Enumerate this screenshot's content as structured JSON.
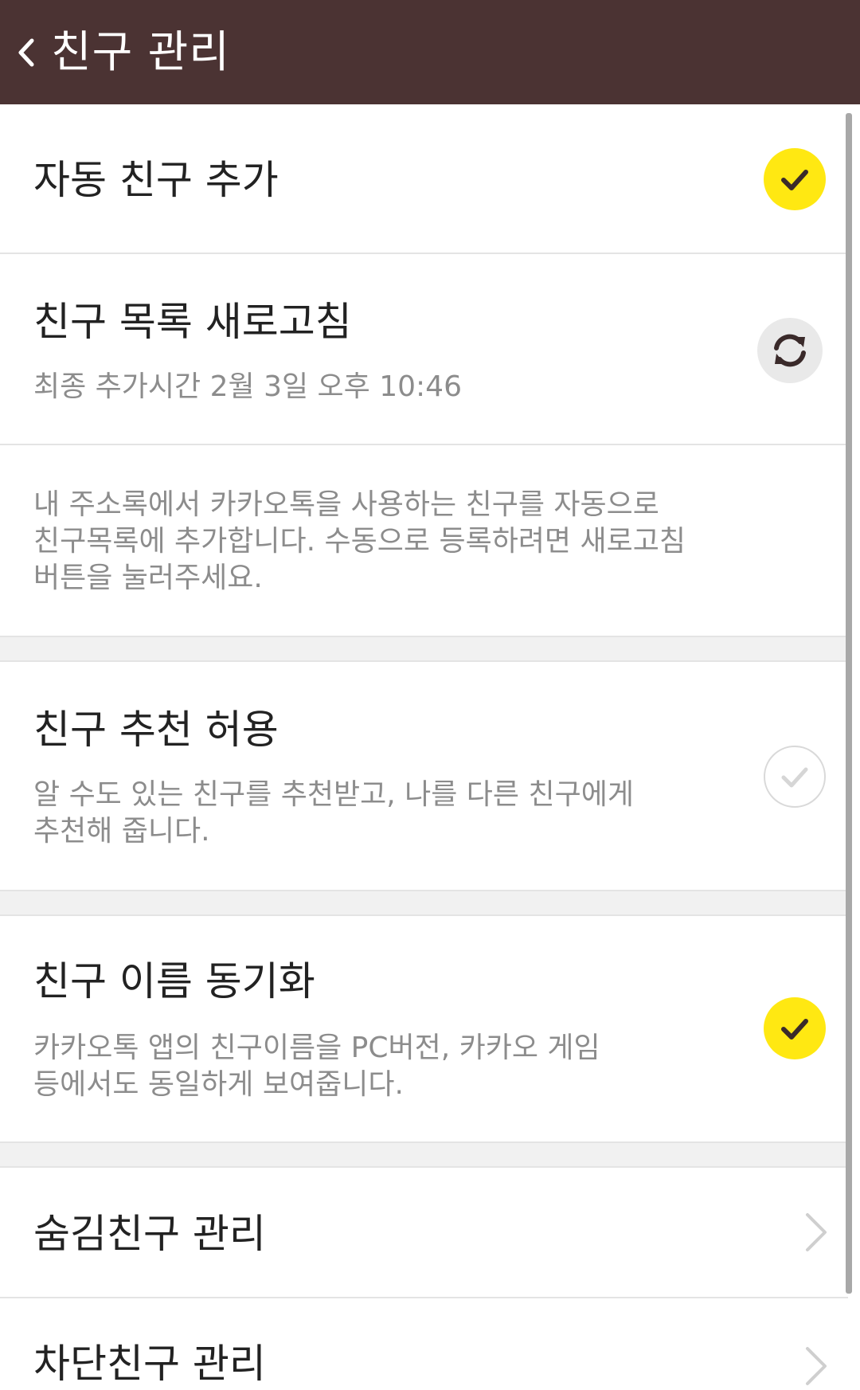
{
  "header": {
    "title": "친구 관리",
    "back_icon": "chevron-left-icon",
    "background": "#4b3333"
  },
  "settings": {
    "auto_add": {
      "title": "자동 친구 추가",
      "checked": true,
      "icon": "check-icon"
    },
    "refresh": {
      "title": "친구 목록 새로고침",
      "last_added": "최종 추가시간 2월 3일 오후 10:46",
      "icon": "refresh-icon"
    },
    "auto_add_description": [
      "내 주소록에서 카카오톡을 사용하는 친구를 자동으로",
      "친구목록에 추가합니다. 수동으로 등록하려면 새로고침",
      "버튼을 눌러주세요."
    ],
    "recommend": {
      "title": "친구 추천 허용",
      "description": [
        "알 수도 있는 친구를 추천받고, 나를 다른 친구에게",
        "추천해 줍니다."
      ],
      "checked": false,
      "icon": "check-icon"
    },
    "name_sync": {
      "title": "친구 이름 동기화",
      "description": [
        "카카오톡 앱의 친구이름을 PC버전, 카카오 게임",
        "등에서도 동일하게 보여줍니다."
      ],
      "checked": true,
      "icon": "check-icon"
    },
    "hidden_friends": {
      "title": "숨김친구 관리",
      "icon": "chevron-right-icon"
    },
    "blocked_friends": {
      "title": "차단친구 관리",
      "icon": "chevron-right-icon"
    }
  },
  "colors": {
    "accent_yellow": "#ffe812",
    "check_mark": "#3a2a2a",
    "secondary_text": "#8c8c8c",
    "section_gap": "#f1f1f1"
  }
}
